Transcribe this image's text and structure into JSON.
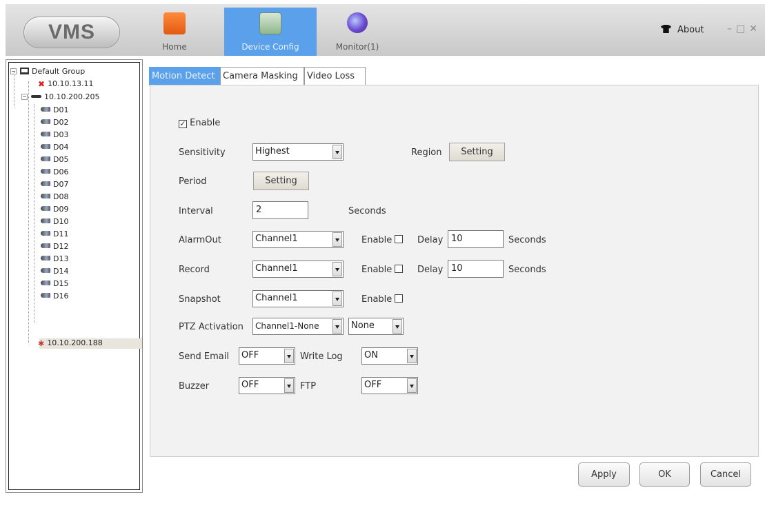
{
  "app": {
    "logo": "VMS"
  },
  "nav": [
    {
      "label": "Home",
      "icon": "home-icon"
    },
    {
      "label": "Device Config",
      "icon": "device-config-icon"
    },
    {
      "label": "Monitor(1)",
      "icon": "monitor-icon"
    }
  ],
  "header": {
    "about_label": "About",
    "window_controls": "–□✕"
  },
  "tree": {
    "group": "Default Group",
    "devices": [
      {
        "label": "10.10.13.11",
        "status": "offline"
      },
      {
        "label": "10.10.200.205",
        "status": "online",
        "channels": [
          "D01",
          "D02",
          "D03",
          "D04",
          "D05",
          "D06",
          "D07",
          "D08",
          "D09",
          "D10",
          "D11",
          "D12",
          "D13",
          "D14",
          "D15",
          "D16"
        ]
      },
      {
        "label": "10.10.200.188",
        "status": "selected"
      }
    ]
  },
  "tabs": [
    "Motion Detect",
    "Camera Masking",
    "Video Loss"
  ],
  "form": {
    "enable_label": "Enable",
    "enable_checked": true,
    "sensitivity": {
      "label": "Sensitivity",
      "value": "Highest"
    },
    "region": {
      "label": "Region",
      "button": "Setting"
    },
    "period": {
      "label": "Period",
      "button": "Setting"
    },
    "interval": {
      "label": "Interval",
      "value": "2",
      "unit": "Seconds"
    },
    "alarmout": {
      "label": "AlarmOut",
      "value": "Channel1",
      "enable_label": "Enable",
      "delay_label": "Delay",
      "delay_value": "10",
      "unit": "Seconds"
    },
    "record": {
      "label": "Record",
      "value": "Channel1",
      "enable_label": "Enable",
      "delay_label": "Delay",
      "delay_value": "10",
      "unit": "Seconds"
    },
    "snapshot": {
      "label": "Snapshot",
      "value": "Channel1",
      "enable_label": "Enable"
    },
    "ptz": {
      "label": "PTZ Activation",
      "value": "Channel1-None",
      "value2": "None"
    },
    "send_email": {
      "label": "Send Email",
      "value": "OFF"
    },
    "write_log": {
      "label": "Write Log",
      "value": "ON"
    },
    "buzzer": {
      "label": "Buzzer",
      "value": "OFF"
    },
    "ftp": {
      "label": "FTP",
      "value": "OFF"
    }
  },
  "buttons": {
    "apply": "Apply",
    "ok": "OK",
    "cancel": "Cancel"
  },
  "colors": {
    "accent": "#5aa0ea",
    "header_bg": "#d6d6d6",
    "panel_bg": "#f2f2f2"
  }
}
